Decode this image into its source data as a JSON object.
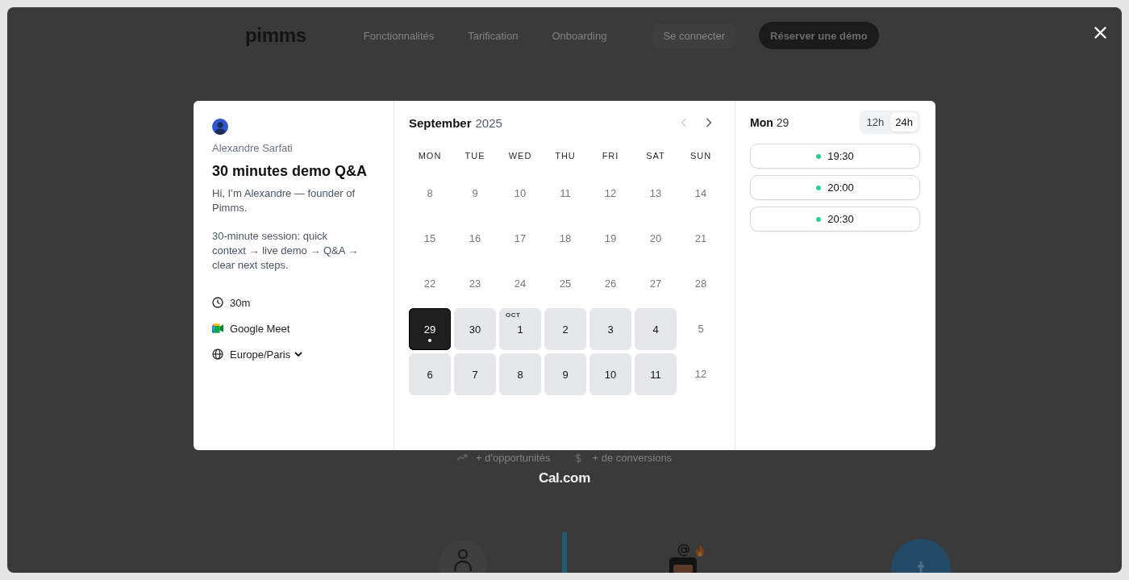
{
  "background_page": {
    "nav": {
      "logo": "pimms",
      "links": [
        "Fonctionnalités",
        "Tarification",
        "Onboarding"
      ],
      "login_button": "Se connecter",
      "cta_button": "Réserver une démo"
    },
    "benefits": [
      {
        "kind": "trend",
        "text": "+ d'opportunités"
      },
      {
        "kind": "money",
        "text": "+ de conversions"
      }
    ]
  },
  "booking": {
    "host": {
      "name": "Alexandre Sarfati"
    },
    "title": "30 minutes demo Q&A",
    "description": [
      "Hi, I’m Alexandre — founder of Pimms.",
      "30-minute session: quick context → live demo → Q&A → clear next steps."
    ],
    "details": [
      {
        "kind": "duration",
        "text": "30m"
      },
      {
        "kind": "video",
        "text": "Google Meet"
      },
      {
        "kind": "timezone",
        "text": "Europe/Paris"
      }
    ],
    "calendar": {
      "month": "September",
      "year": "2025",
      "nav": [
        {
          "kind": "previous",
          "disabled": true
        },
        {
          "kind": "next",
          "disabled": false
        }
      ],
      "weekdays": [
        "MON",
        "TUE",
        "WED",
        "THU",
        "FRI",
        "SAT",
        "SUN"
      ],
      "weeks": [
        [
          {
            "day": "8",
            "available": false,
            "selected": false,
            "today": false
          },
          {
            "day": "9",
            "available": false,
            "selected": false,
            "today": false
          },
          {
            "day": "10",
            "available": false,
            "selected": false,
            "today": false
          },
          {
            "day": "11",
            "available": false,
            "selected": false,
            "today": false
          },
          {
            "day": "12",
            "available": false,
            "selected": false,
            "today": false
          },
          {
            "day": "13",
            "available": false,
            "selected": false,
            "today": false
          },
          {
            "day": "14",
            "available": false,
            "selected": false,
            "today": false
          }
        ],
        [
          {
            "day": "15",
            "available": false,
            "selected": false,
            "today": false
          },
          {
            "day": "16",
            "available": false,
            "selected": false,
            "today": false
          },
          {
            "day": "17",
            "available": false,
            "selected": false,
            "today": false
          },
          {
            "day": "18",
            "available": false,
            "selected": false,
            "today": false
          },
          {
            "day": "19",
            "available": false,
            "selected": false,
            "today": false
          },
          {
            "day": "20",
            "available": false,
            "selected": false,
            "today": false
          },
          {
            "day": "21",
            "available": false,
            "selected": false,
            "today": false
          }
        ],
        [
          {
            "day": "22",
            "available": false,
            "selected": false,
            "today": false
          },
          {
            "day": "23",
            "available": false,
            "selected": false,
            "today": false
          },
          {
            "day": "24",
            "available": false,
            "selected": false,
            "today": false
          },
          {
            "day": "25",
            "available": false,
            "selected": false,
            "today": false
          },
          {
            "day": "26",
            "available": false,
            "selected": false,
            "today": false
          },
          {
            "day": "27",
            "available": false,
            "selected": false,
            "today": false
          },
          {
            "day": "28",
            "available": false,
            "selected": false,
            "today": false
          }
        ],
        [
          {
            "day": "29",
            "available": true,
            "selected": true,
            "today": true
          },
          {
            "day": "30",
            "available": true,
            "selected": false,
            "today": false
          },
          {
            "day": "1",
            "month_label": "OCT",
            "available": true,
            "selected": false,
            "today": false
          },
          {
            "day": "2",
            "available": true,
            "selected": false,
            "today": false
          },
          {
            "day": "3",
            "available": true,
            "selected": false,
            "today": false
          },
          {
            "day": "4",
            "available": true,
            "selected": false,
            "today": false
          },
          {
            "day": "5",
            "available": false,
            "selected": false,
            "today": false
          }
        ],
        [
          {
            "day": "6",
            "available": true,
            "selected": false,
            "today": false
          },
          {
            "day": "7",
            "available": true,
            "selected": false,
            "today": false
          },
          {
            "day": "8",
            "available": true,
            "selected": false,
            "today": false
          },
          {
            "day": "9",
            "available": true,
            "selected": false,
            "today": false
          },
          {
            "day": "10",
            "available": true,
            "selected": false,
            "today": false
          },
          {
            "day": "11",
            "available": true,
            "selected": false,
            "today": false
          },
          {
            "day": "12",
            "available": false,
            "selected": false,
            "today": false
          }
        ]
      ]
    },
    "day_panel": {
      "weekday": "Mon",
      "day": "29",
      "formats": [
        {
          "label": "12h",
          "selected": false
        },
        {
          "label": "24h",
          "selected": true
        }
      ],
      "slots": [
        "19:30",
        "20:00",
        "20:30"
      ]
    }
  },
  "branding": "Cal.com"
}
